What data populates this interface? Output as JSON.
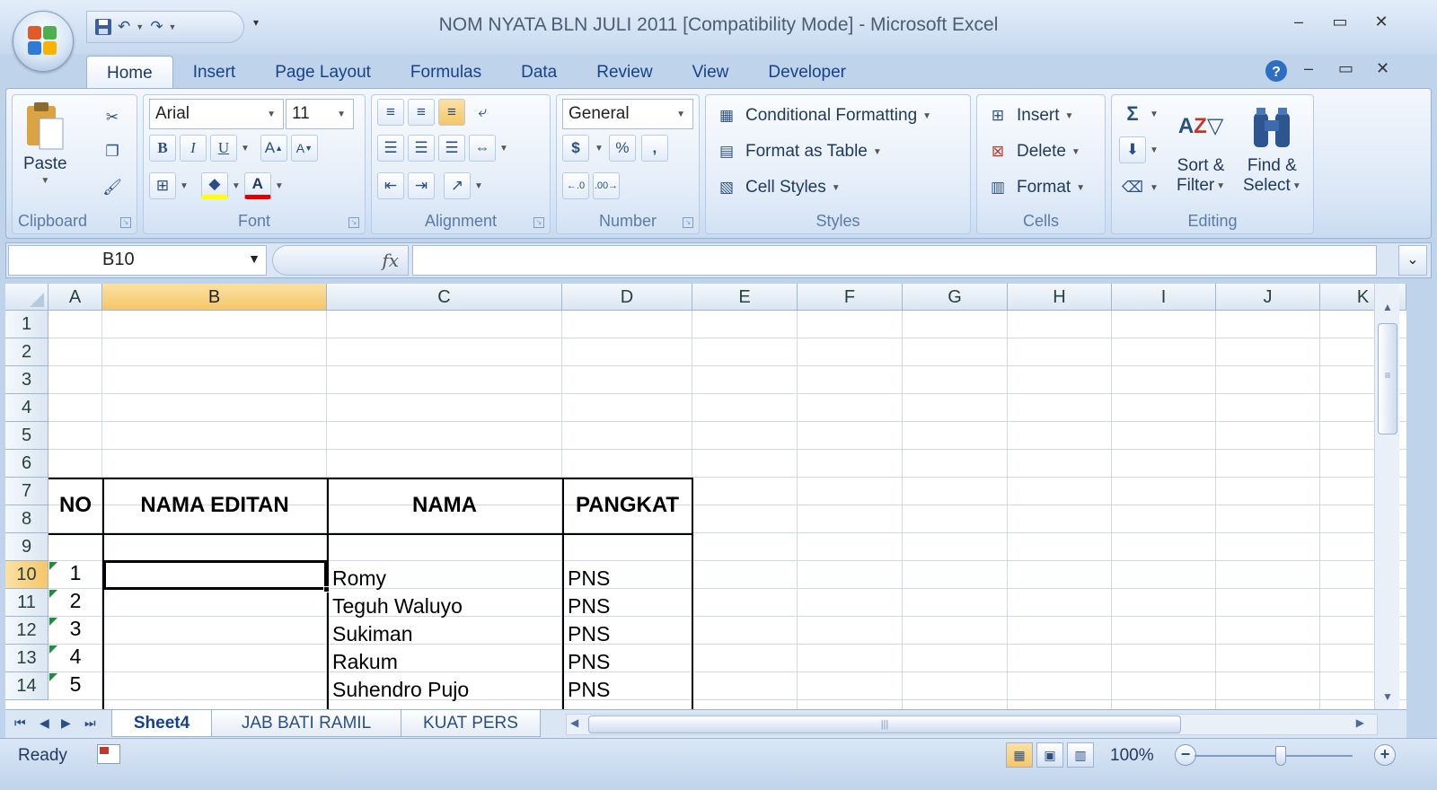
{
  "window": {
    "title": "NOM NYATA BLN JULI 2011  [Compatibility Mode] - Microsoft Excel",
    "minimize": "–",
    "maximize": "▭",
    "close": "✕"
  },
  "quick_access": {
    "save_icon": "save-icon",
    "undo_icon": "undo-icon",
    "redo_icon": "redo-icon"
  },
  "tabs": [
    "Home",
    "Insert",
    "Page Layout",
    "Formulas",
    "Data",
    "Review",
    "View",
    "Developer"
  ],
  "ribbon": {
    "clipboard": {
      "label": "Clipboard",
      "paste": "Paste"
    },
    "font": {
      "label": "Font",
      "font_name": "Arial",
      "font_size": "11",
      "bold": "B",
      "italic": "I",
      "underline": "U"
    },
    "alignment": {
      "label": "Alignment"
    },
    "number": {
      "label": "Number",
      "format": "General",
      "currency": "$",
      "percent": "%",
      "comma": ","
    },
    "styles": {
      "label": "Styles",
      "conditional": "Conditional Formatting",
      "format_table": "Format as Table",
      "cell_styles": "Cell Styles"
    },
    "cells": {
      "label": "Cells",
      "insert": "Insert",
      "delete": "Delete",
      "format": "Format"
    },
    "editing": {
      "label": "Editing",
      "sort": "Sort &",
      "sort2": "Filter",
      "find": "Find &",
      "find2": "Select",
      "sigma": "Σ"
    }
  },
  "formula_bar": {
    "name_box": "B10",
    "fx": "fx",
    "formula": ""
  },
  "columns": [
    "A",
    "B",
    "C",
    "D",
    "E",
    "F",
    "G",
    "H",
    "I",
    "J",
    "K"
  ],
  "selected_column": "B",
  "rows": [
    "1",
    "2",
    "3",
    "4",
    "5",
    "6",
    "7",
    "8",
    "9",
    "10",
    "11",
    "12",
    "13",
    "14"
  ],
  "selected_row": "10",
  "table": {
    "headers": {
      "no": "NO",
      "nama_editan": "NAMA EDITAN",
      "nama": "NAMA",
      "pangkat": "PANGKAT"
    },
    "records": [
      {
        "no": "1",
        "nama": "Romy",
        "pangkat": "PNS"
      },
      {
        "no": "2",
        "nama": "Teguh Waluyo",
        "pangkat": "PNS"
      },
      {
        "no": "3",
        "nama": "Sukiman",
        "pangkat": "PNS"
      },
      {
        "no": "4",
        "nama": "Rakum",
        "pangkat": "PNS"
      },
      {
        "no": "5",
        "nama": "Suhendro Pujo",
        "pangkat": "PNS"
      }
    ]
  },
  "sheet_tabs": [
    "Sheet4",
    "JAB BATI RAMIL",
    "KUAT PERS"
  ],
  "active_sheet": "Sheet4",
  "status": {
    "text": "Ready",
    "zoom": "100%"
  }
}
